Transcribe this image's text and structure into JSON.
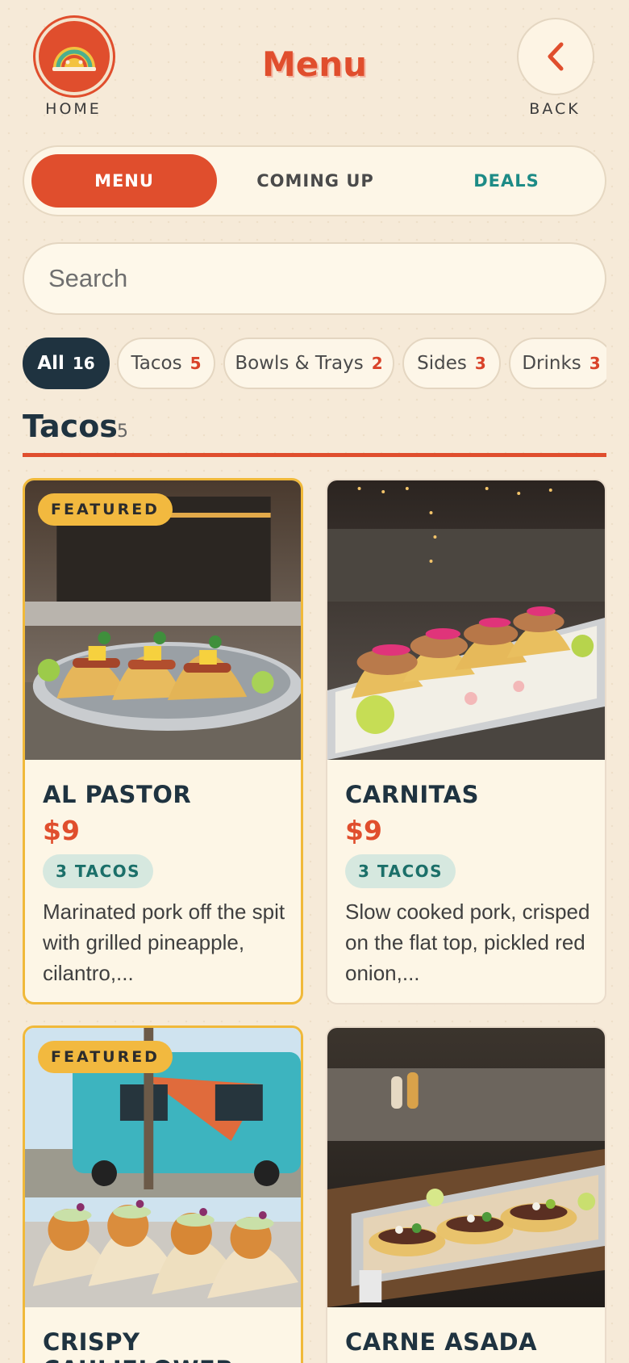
{
  "header": {
    "title": "Menu",
    "home_label": "HOME",
    "back_label": "BACK"
  },
  "tabs": [
    {
      "label": "MENU",
      "active": true
    },
    {
      "label": "COMING UP",
      "active": false
    },
    {
      "label": "DEALS",
      "active": false
    }
  ],
  "search": {
    "placeholder": "Search",
    "value": ""
  },
  "categories": [
    {
      "label": "All",
      "count": "16",
      "active": true
    },
    {
      "label": "Tacos",
      "count": "5",
      "active": false
    },
    {
      "label": "Bowls & Trays",
      "count": "2",
      "active": false
    },
    {
      "label": "Sides",
      "count": "3",
      "active": false
    },
    {
      "label": "Drinks",
      "count": "3",
      "active": false
    }
  ],
  "section": {
    "title": "Tacos",
    "count": "5"
  },
  "items": [
    {
      "badge": "FEATURED",
      "name": "AL PASTOR",
      "price": "$9",
      "quantity": "3 TACOS",
      "description": "Marinated pork off the spit with grilled pineapple, cilantro,..."
    },
    {
      "badge": "",
      "name": "CARNITAS",
      "price": "$9",
      "quantity": "3 TACOS",
      "description": "Slow cooked pork, crisped on the flat top, pickled red onion,..."
    },
    {
      "badge": "FEATURED",
      "name": "CRISPY CAULIFLOWER"
    },
    {
      "badge": "",
      "name": "CARNE ASADA"
    }
  ],
  "colors": {
    "accent": "#e04e2d",
    "dark": "#1f3340",
    "teal": "#1d8b86",
    "featured": "#f0b93a",
    "background": "#f6ead8"
  },
  "icons": {
    "home": "taco-logo-icon",
    "back": "chevron-left-icon"
  }
}
